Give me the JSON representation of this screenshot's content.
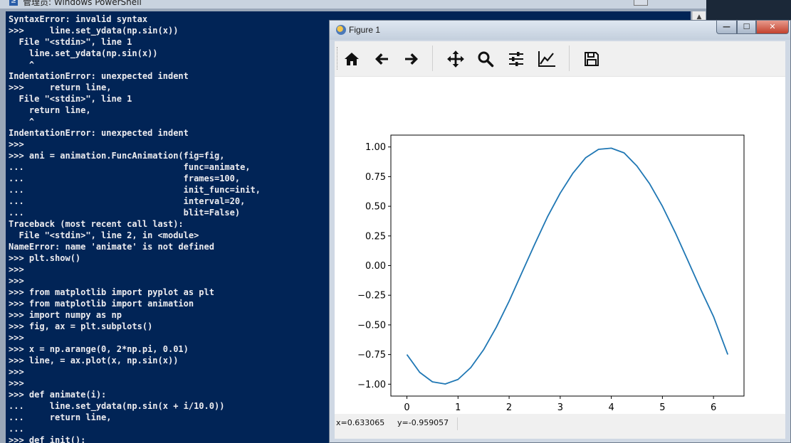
{
  "powershell": {
    "title": "管理员: Windows PowerShell",
    "console_lines": [
      "SyntaxError: invalid syntax",
      ">>>     line.set_ydata(np.sin(x))",
      "  File \"<stdin>\", line 1",
      "    line.set_ydata(np.sin(x))",
      "    ^",
      "IndentationError: unexpected indent",
      ">>>     return line,",
      "  File \"<stdin>\", line 1",
      "    return line,",
      "    ^",
      "IndentationError: unexpected indent",
      ">>>",
      ">>> ani = animation.FuncAnimation(fig=fig,",
      "...                               func=animate,",
      "...                               frames=100,",
      "...                               init_func=init,",
      "...                               interval=20,",
      "...                               blit=False)",
      "Traceback (most recent call last):",
      "  File \"<stdin>\", line 2, in <module>",
      "NameError: name 'animate' is not defined",
      ">>> plt.show()",
      ">>>",
      ">>>",
      ">>> from matplotlib import pyplot as plt",
      ">>> from matplotlib import animation",
      ">>> import numpy as np",
      ">>> fig, ax = plt.subplots()",
      ">>>",
      ">>> x = np.arange(0, 2*np.pi, 0.01)",
      ">>> line, = ax.plot(x, np.sin(x))",
      ">>>",
      ">>>",
      ">>> def animate(i):",
      "...     line.set_ydata(np.sin(x + i/10.0))",
      "...     return line,",
      "...",
      ">>> def init():"
    ],
    "colors": {
      "background": "#012456",
      "text": "#eeedf0"
    }
  },
  "figure": {
    "title": "Figure 1",
    "window_buttons": {
      "minimize": "—",
      "maximize": "☐",
      "close": "✕"
    },
    "toolbar": [
      {
        "name": "home-icon",
        "tooltip": "Home"
      },
      {
        "name": "back-arrow-icon",
        "tooltip": "Back"
      },
      {
        "name": "forward-arrow-icon",
        "tooltip": "Forward"
      },
      {
        "name": "pan-icon",
        "tooltip": "Pan"
      },
      {
        "name": "zoom-icon",
        "tooltip": "Zoom"
      },
      {
        "name": "configure-subplots-icon",
        "tooltip": "Subplots"
      },
      {
        "name": "edit-axis-icon",
        "tooltip": "Customize"
      },
      {
        "name": "save-icon",
        "tooltip": "Save"
      }
    ],
    "status": {
      "x": "x=0.633065",
      "y": "y=-0.959057"
    }
  },
  "chart_data": {
    "type": "line",
    "title": "",
    "xlabel": "",
    "ylabel": "",
    "xlim": [
      -0.314,
      6.597
    ],
    "ylim": [
      -1.1,
      1.1
    ],
    "xticks": [
      0,
      1,
      2,
      3,
      4,
      5,
      6
    ],
    "xtick_labels": [
      "0",
      "1",
      "2",
      "3",
      "4",
      "5",
      "6"
    ],
    "yticks": [
      1.0,
      0.75,
      0.5,
      0.25,
      0.0,
      -0.25,
      -0.5,
      -0.75,
      -1.0
    ],
    "ytick_labels": [
      "1.00",
      "0.75",
      "0.50",
      "0.25",
      "0.00",
      "−0.25",
      "−0.50",
      "−0.75",
      "−1.00"
    ],
    "grid": false,
    "series": [
      {
        "color": "#1f77b4",
        "x": [
          0,
          0.25,
          0.5,
          0.75,
          1.0,
          1.25,
          1.5,
          1.75,
          2.0,
          2.25,
          2.5,
          2.75,
          3.0,
          3.25,
          3.5,
          3.75,
          4.0,
          4.25,
          4.5,
          4.75,
          5.0,
          5.25,
          5.5,
          5.75,
          6.0,
          6.28
        ],
        "y": [
          -0.75,
          -0.9,
          -0.98,
          -0.998,
          -0.96,
          -0.86,
          -0.71,
          -0.52,
          -0.3,
          -0.06,
          0.18,
          0.41,
          0.61,
          0.78,
          0.91,
          0.98,
          0.99,
          0.95,
          0.84,
          0.69,
          0.5,
          0.28,
          0.04,
          -0.2,
          -0.43,
          -0.75
        ]
      }
    ]
  }
}
